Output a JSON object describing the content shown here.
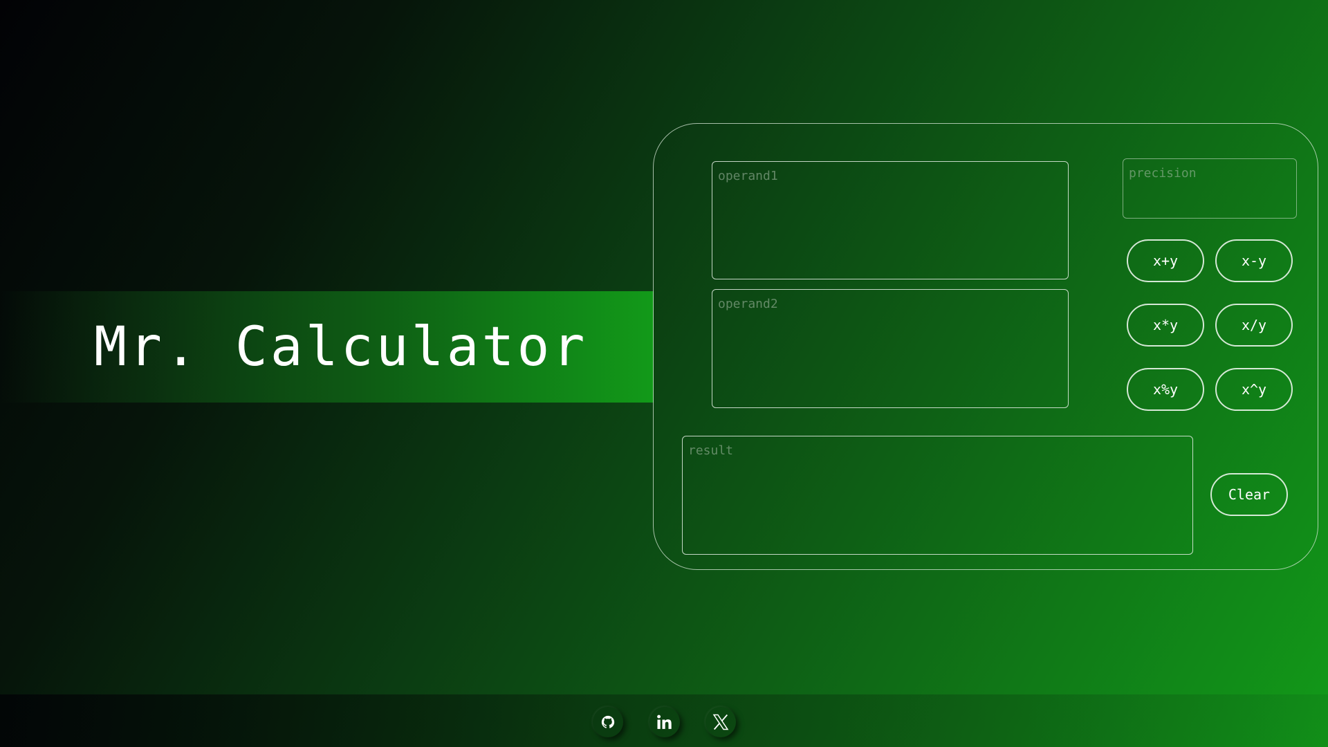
{
  "app": {
    "title": "Mr. Calculator"
  },
  "calculator": {
    "operand1_placeholder": "operand1",
    "operand2_placeholder": "operand2",
    "precision_placeholder": "precision",
    "result_placeholder": "result",
    "buttons": {
      "add": "x+y",
      "subtract": "x-y",
      "multiply": "x*y",
      "divide": "x/y",
      "modulo": "x%y",
      "power": "x^y",
      "clear": "Clear"
    }
  },
  "footer": {
    "social": [
      {
        "icon": "github-icon"
      },
      {
        "icon": "linkedin-icon"
      },
      {
        "icon": "x-twitter-icon"
      }
    ]
  },
  "colors": {
    "accent": "#129a19",
    "background_dark": "#020205",
    "text": "#ffffff"
  }
}
